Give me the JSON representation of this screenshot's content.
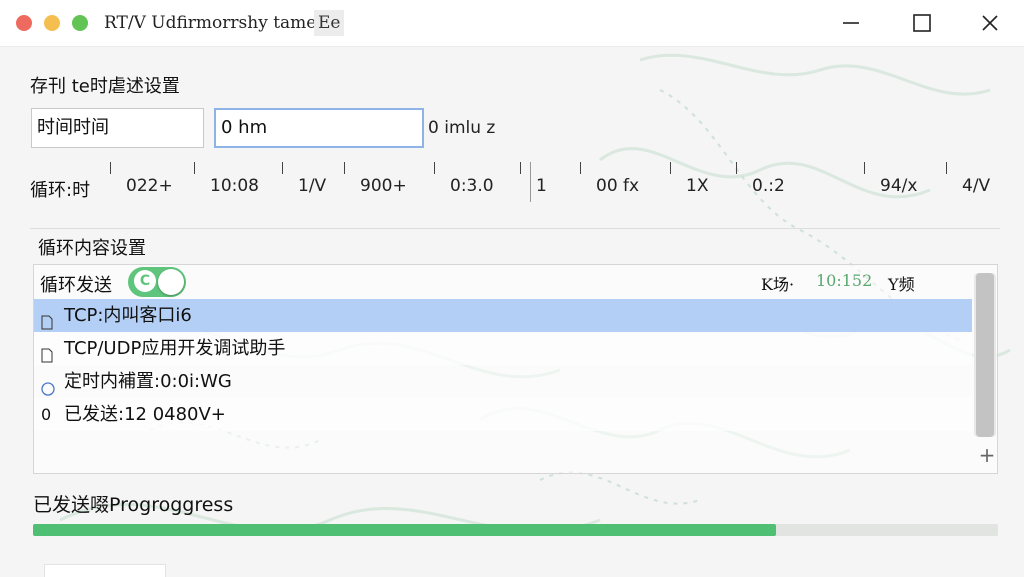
{
  "window": {
    "title": "RT/V Udfirmorrshy tame",
    "title_tag": "Ee"
  },
  "schedule": {
    "section_title": "存刊 te时虐述设置",
    "time_field_value": "时间时间",
    "duration_field_value": "0 hm",
    "unit_label": "0 imlu z"
  },
  "ruler": {
    "label": "循环:时",
    "ticks": [
      "022+",
      "10:08",
      "1/V",
      "900+",
      "0:3.0",
      "1",
      "00 fx",
      "1X",
      "0.:2",
      "94/x",
      "4/V"
    ]
  },
  "loop": {
    "section_title": "循环内容设置",
    "send_label": "循环发送",
    "toggle_letter": "C",
    "toggle_on": true,
    "status_prefix": "K场·",
    "status_time": "10:152",
    "status_suffix": "Y频",
    "rows": [
      {
        "icon": "document-icon",
        "text": "TCP:内叫客口i6"
      },
      {
        "icon": "document-icon",
        "text": "TCP/UDP应用开发调试助手"
      },
      {
        "icon": "circle-icon",
        "text": "定时内補置:0:0i:WG"
      },
      {
        "icon": "zero-icon",
        "text": "已发送:12 0480V+"
      }
    ]
  },
  "progress": {
    "title": "已发送啜Progroggress",
    "percent": 77
  },
  "colors": {
    "accent_green": "#4fbf73",
    "selection_blue": "#b4cff5",
    "close_red": "#ee6a5f",
    "minimize_yellow": "#f5bf4f",
    "maximize_green": "#61c454"
  }
}
